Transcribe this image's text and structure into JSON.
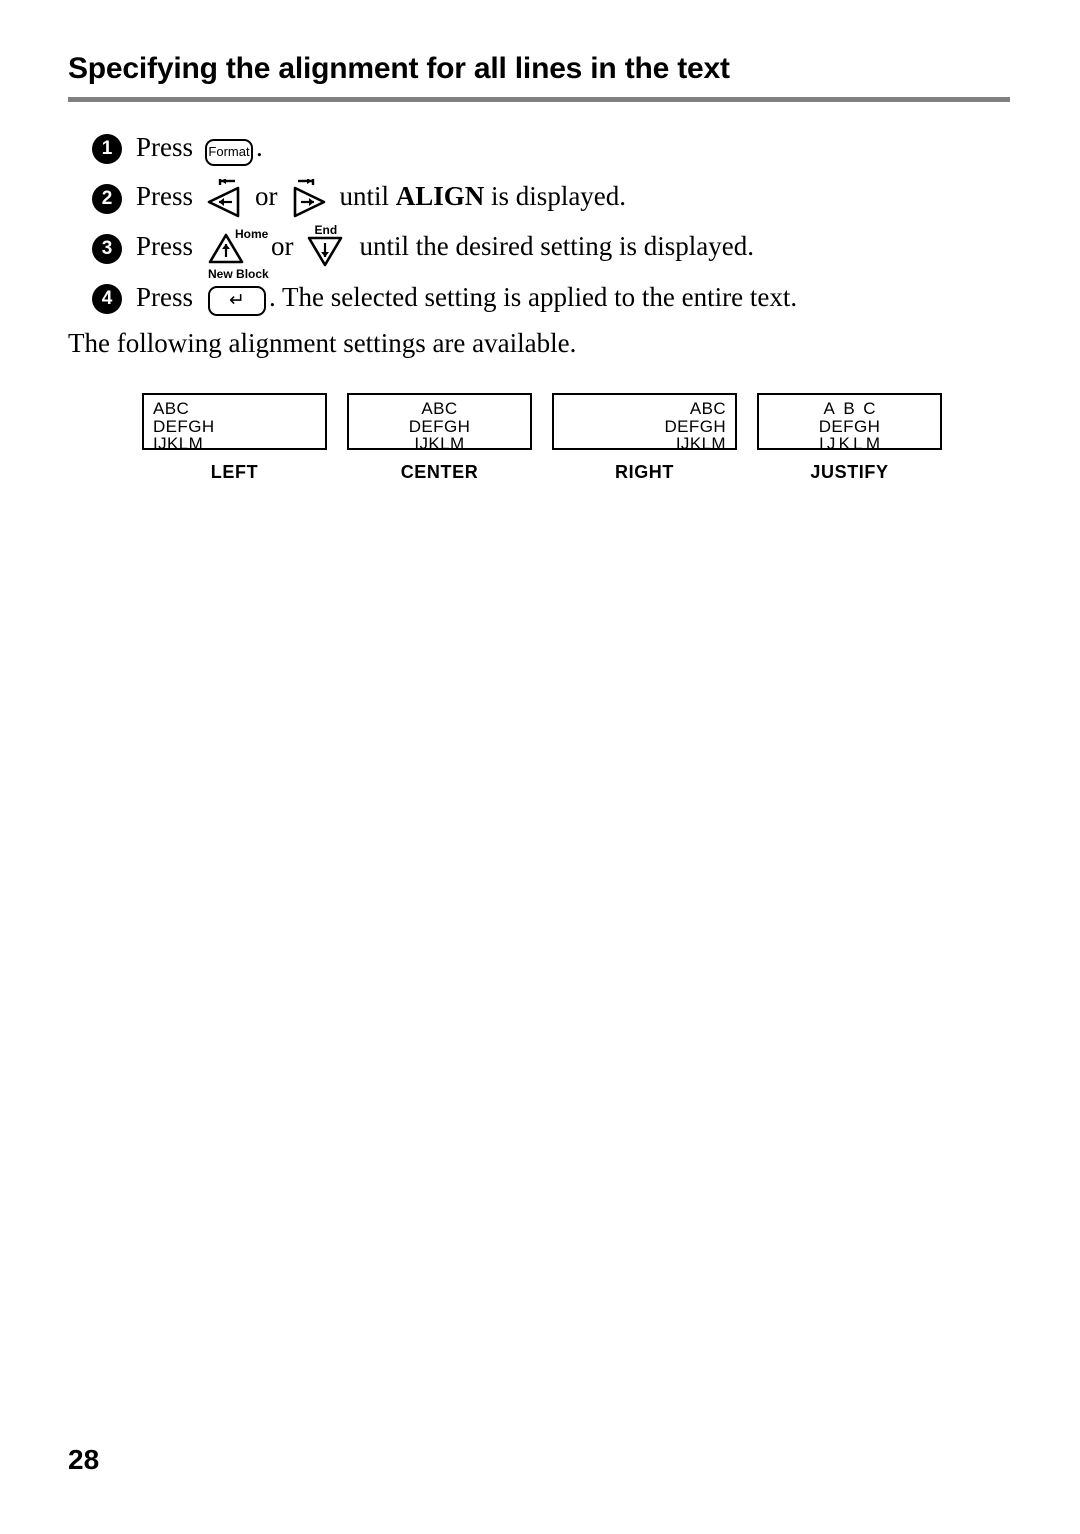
{
  "header": {
    "title": "Specifying the alignment for all lines in the text"
  },
  "steps": [
    {
      "number": "1",
      "press_label": "Press",
      "keys": [
        {
          "icon": "format-key-icon",
          "cap": "Format",
          "top_label": ""
        }
      ],
      "tail": "."
    },
    {
      "number": "2",
      "press_label": "Press",
      "keys": [
        {
          "icon": "arrow-left-key-icon",
          "cap": "←",
          "top_label": ""
        },
        {
          "icon": "arrow-right-key-icon",
          "cap": "→",
          "top_label": ""
        }
      ],
      "conjunction": "or",
      "tail_before_bold": "until ",
      "bold_word": "ALIGN",
      "tail_after_bold": " is displayed."
    },
    {
      "number": "3",
      "press_label": "Press",
      "keys": [
        {
          "icon": "arrow-up-key-icon",
          "cap": "↑",
          "top_label": "Home"
        },
        {
          "icon": "arrow-down-key-icon",
          "cap": "↓",
          "top_label": "End"
        }
      ],
      "conjunction": "or",
      "tail": "until the desired setting is displayed."
    },
    {
      "number": "4",
      "press_label": "Press",
      "keys": [
        {
          "icon": "enter-key-icon",
          "cap": "↵",
          "top_label": "New Block"
        }
      ],
      "tail": ". The selected setting is applied to the entire text."
    }
  ],
  "intro_text": "The following alignment settings are available.",
  "samples": [
    {
      "caption": "LEFT",
      "align": "left",
      "lines": [
        "ABC",
        "DEFGH",
        "IJKLM"
      ]
    },
    {
      "caption": "CENTER",
      "align": "center",
      "lines": [
        "ABC",
        "DEFGH",
        "IJKLM"
      ]
    },
    {
      "caption": "RIGHT",
      "align": "right",
      "lines": [
        "ABC",
        "DEFGH",
        "IJKLM"
      ]
    },
    {
      "caption": "JUSTIFY",
      "align": "justify",
      "lines": [
        "ABC",
        "DEFGH",
        "IJKLM"
      ]
    }
  ],
  "footer": {
    "page_number": "28"
  },
  "colors": {
    "ink": "#000000",
    "rule": "#808080",
    "paper": "#ffffff"
  }
}
